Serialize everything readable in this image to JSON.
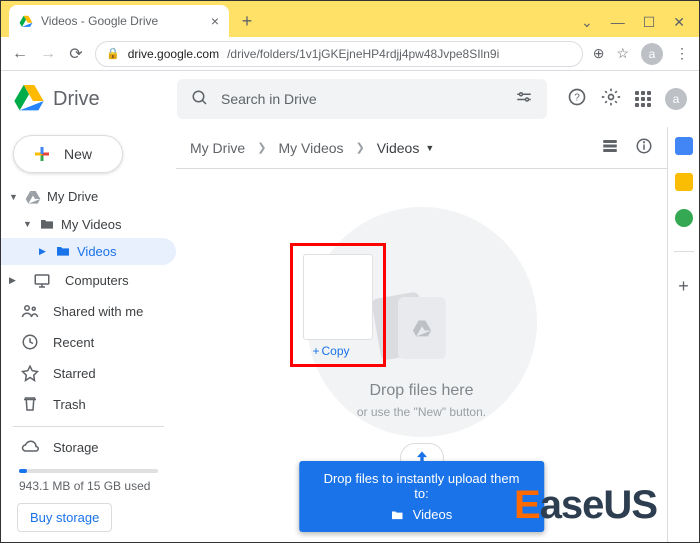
{
  "browser": {
    "tab_title": "Videos - Google Drive",
    "url_host": "drive.google.com",
    "url_path": "/drive/folders/1v1jGKEjneHP4rdjj4pw48Jvpe8SIln9i",
    "account_initial": "a"
  },
  "header": {
    "product": "Drive",
    "search_placeholder": "Search in Drive"
  },
  "sidebar": {
    "new_label": "New",
    "tree": {
      "root": "My Drive",
      "folder1": "My Videos",
      "folder2": "Videos"
    },
    "items": {
      "computers": "Computers",
      "shared": "Shared with me",
      "recent": "Recent",
      "starred": "Starred",
      "trash": "Trash",
      "storage": "Storage"
    },
    "storage_text": "943.1 MB of 15 GB used",
    "buy_label": "Buy storage"
  },
  "breadcrumb": {
    "a": "My Drive",
    "b": "My Videos",
    "c": "Videos"
  },
  "dropzone": {
    "title": "Drop files here",
    "subtitle": "or use the \"New\" button.",
    "copy_label": "Copy"
  },
  "banner": {
    "line1": "Drop files to instantly upload them to:",
    "target": "Videos"
  },
  "watermark": "aseUS"
}
